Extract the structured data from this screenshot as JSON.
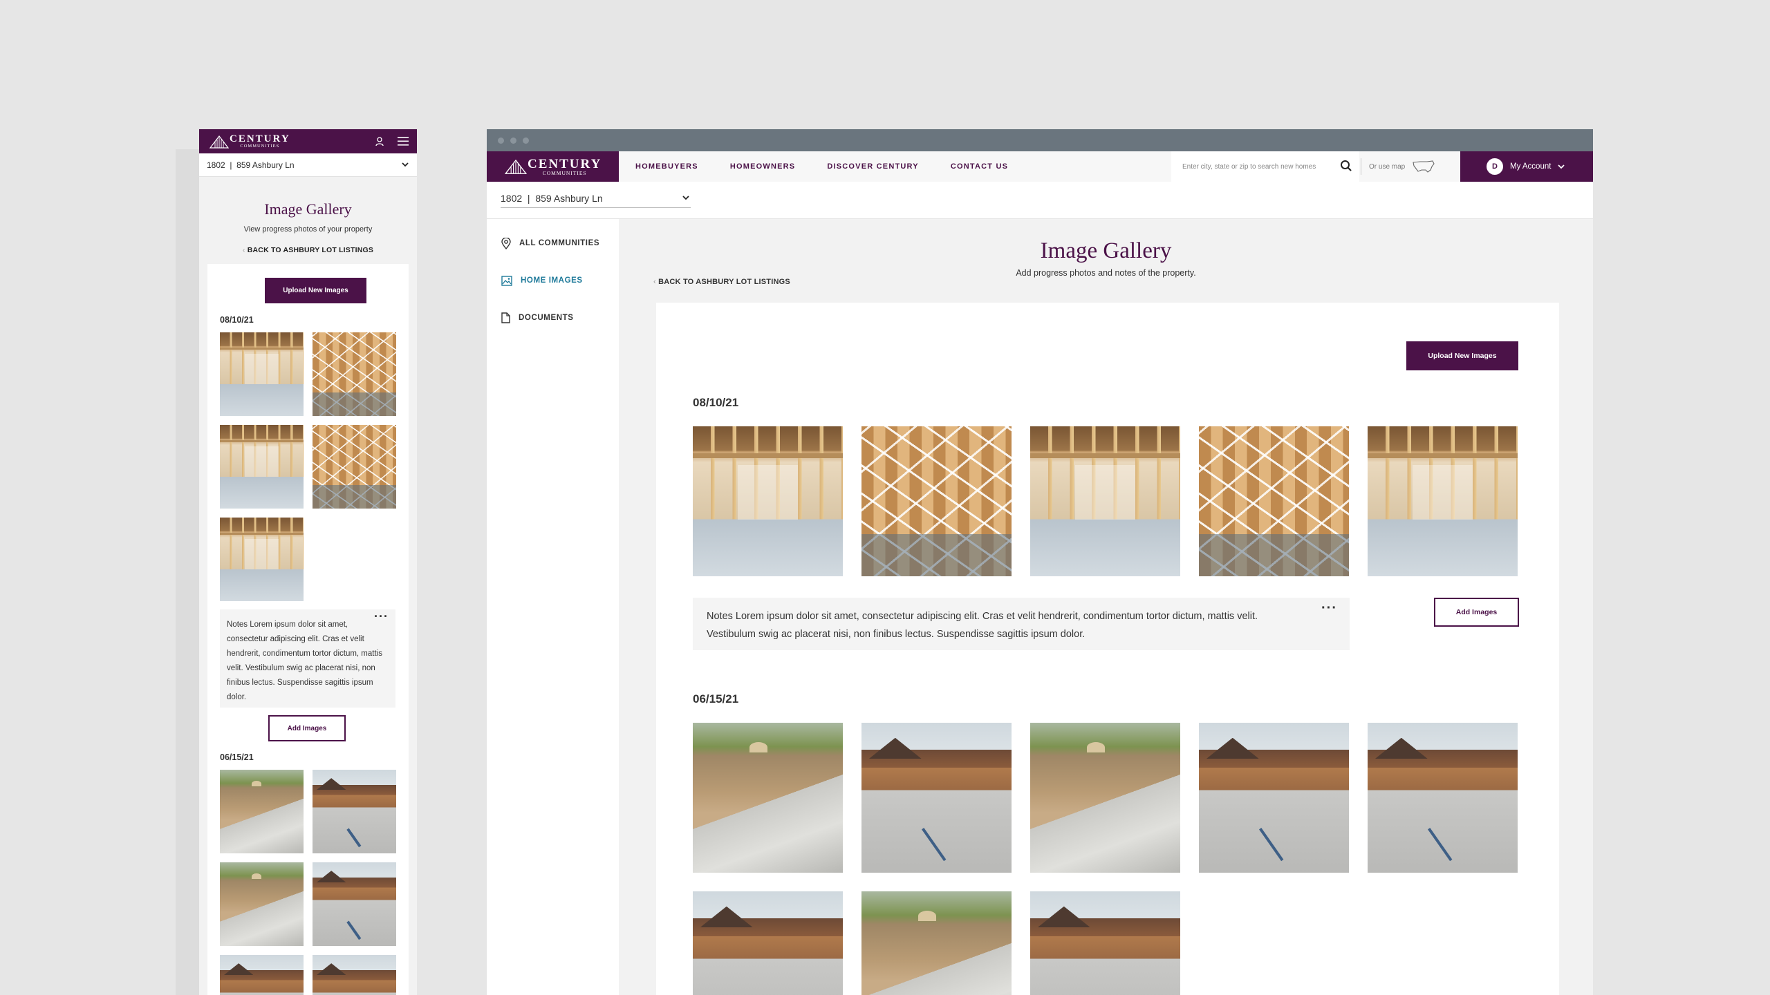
{
  "brand": {
    "name": "CENTURY",
    "sub": "COMMUNITIES",
    "color": "#4b1248",
    "link_color": "#1f7a9a"
  },
  "property_select": {
    "value": "1802  |  859 Ashbury Ln"
  },
  "mobile": {
    "title": "Image Gallery",
    "subtitle": "View progress photos of your property",
    "back_link": "BACK TO ASHBURY LOT LISTINGS",
    "upload_button": "Upload New Images",
    "groups": [
      {
        "date": "08/10/21"
      },
      {
        "date": "06/15/21"
      }
    ],
    "notes": "Notes Lorem ipsum dolor sit amet, consectetur adipiscing elit. Cras et velit hendrerit, condimentum tortor dictum, mattis velit. Vestibulum swig ac placerat nisi, non finibus lectus. Suspendisse sagittis ipsum dolor.",
    "notes_menu": "···",
    "add_images_button": "Add Images"
  },
  "desktop": {
    "nav": [
      "HOMEBUYERS",
      "HOMEOWNERS",
      "DISCOVER CENTURY",
      "CONTACT US"
    ],
    "search_placeholder": "Enter city, state or zip to search new homes",
    "map_label": "Or use map",
    "account": {
      "initial": "D",
      "label": "My Account"
    },
    "sidebar": [
      "ALL COMMUNITIES",
      "HOME IMAGES",
      "DOCUMENTS"
    ],
    "title": "Image Gallery",
    "subtitle": "Add progress photos and notes of the property.",
    "back_link": "BACK TO ASHBURY LOT LISTINGS",
    "upload_button": "Upload New Images",
    "groups": [
      {
        "date": "08/10/21"
      },
      {
        "date": "06/15/21"
      }
    ],
    "notes_line1": "Notes Lorem ipsum dolor sit amet, consectetur adipiscing elit. Cras et velit hendrerit, condimentum tortor dictum, mattis velit.",
    "notes_line2": "Vestibulum swig ac placerat nisi, non finibus lectus. Suspendisse sagittis ipsum dolor.",
    "notes_menu": "···",
    "add_images_button": "Add Images"
  }
}
